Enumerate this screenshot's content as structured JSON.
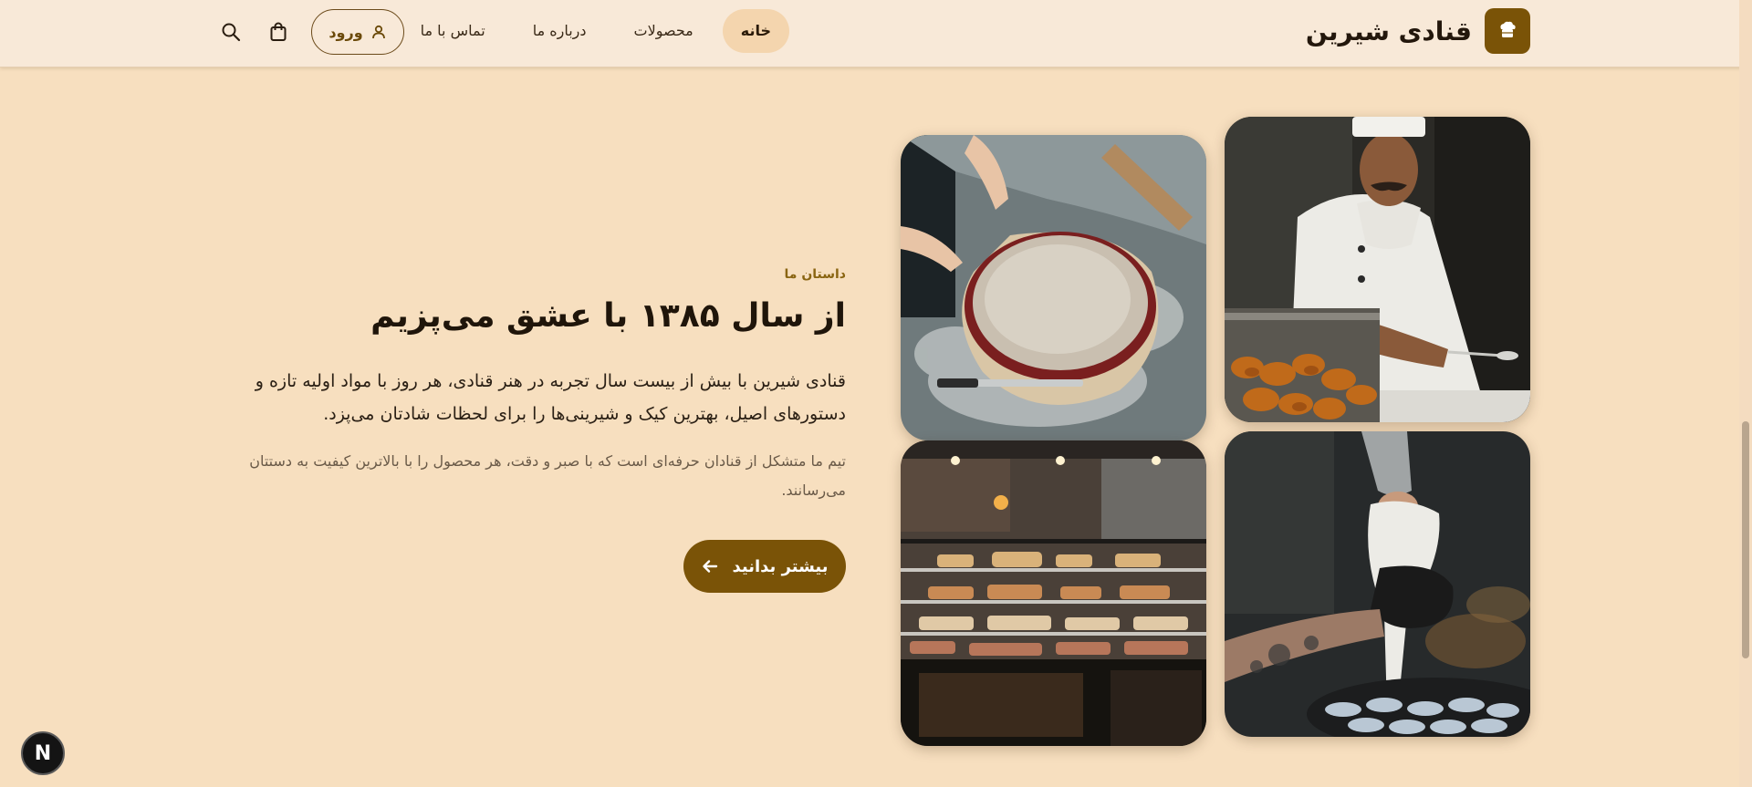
{
  "header": {
    "brand_name": "قنادی شیرین",
    "nav": [
      {
        "label": "خانه",
        "active": true
      },
      {
        "label": "محصولات",
        "active": false
      },
      {
        "label": "درباره ما",
        "active": false
      },
      {
        "label": "تماس با ما",
        "active": false
      }
    ],
    "login_label": "ورود",
    "icons": [
      "bakery-logo-icon",
      "search-icon",
      "shopping-bag-icon",
      "user-icon"
    ]
  },
  "story": {
    "eyebrow": "داستان ما",
    "headline": "از سال ۱۳۸۵ با عشق می‌پزیم",
    "paragraph1": "قنادی شیرین با بیش از بیست سال تجربه در هنر قنادی، هر روز با مواد اولیه تازه و دستورهای اصیل، بهترین کیک و شیرینی‌ها را برای لحظات شادتان می‌پزد.",
    "paragraph2": "تیم ما متشکل از قنادان حرفه‌ای است که با صبر و دقت، هر محصول را با بالاترین کیفیت به دستتان می‌رسانند.",
    "cta_label": "بیشتر بدانید"
  },
  "badge": {
    "letter": "N"
  },
  "colors": {
    "background": "#f7dfbf",
    "header_bg": "#f8e9d8",
    "brand": "#7a5307",
    "active_nav": "#f4d5ae",
    "eyebrow": "#8a6512"
  }
}
